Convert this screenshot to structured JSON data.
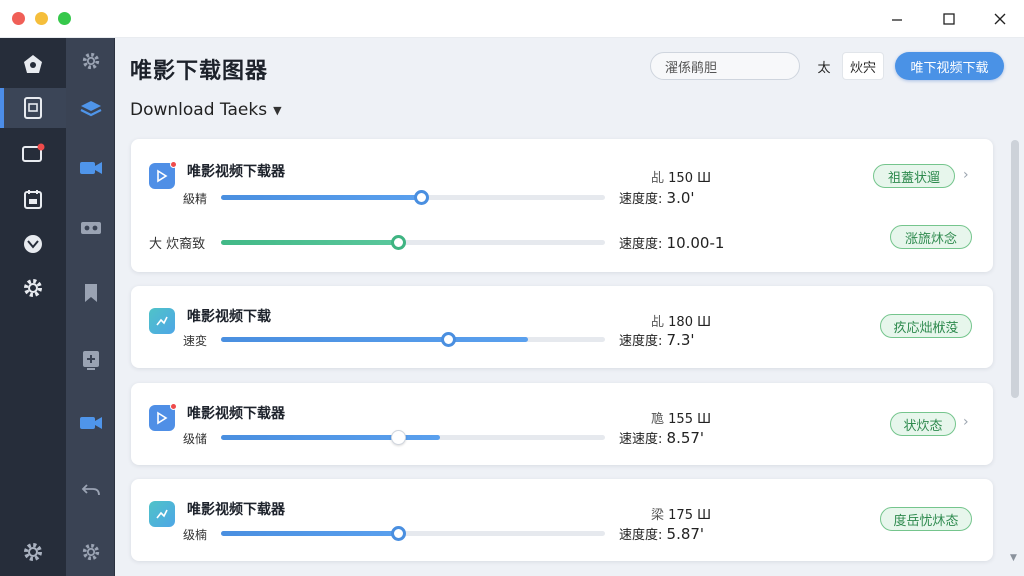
{
  "app": {
    "title": "唯影下载图器"
  },
  "toolbar": {
    "search_value": "濯係鹃胆",
    "btn_a": "太",
    "btn_b": "炏宍",
    "primary": "唯下视频下载"
  },
  "section": {
    "title": "Download Taeks"
  },
  "tasks": [
    {
      "name": "唯影视频下载器",
      "sub": "級精",
      "size_prefix": "乩",
      "size": "150 Ш",
      "speed_label": "速度度:",
      "speed": "3.0'",
      "status": "祖蓋状遛",
      "progress": 0.52,
      "icon": "play-icon",
      "has_chevron": true,
      "sub_row": {
        "label": "大 炊裔致",
        "speed_label": "速度度:",
        "speed": "10.00-1",
        "status": "涨旒炑念",
        "progress": 0.46
      }
    },
    {
      "name": "唯影视频下载",
      "sub": "速変",
      "size_prefix": "乩",
      "size": "180 Ш",
      "speed_label": "速度度:",
      "speed": "7.3'",
      "status": "疚応炪栿莈",
      "progress": 0.8,
      "icon": "chart-icon",
      "has_chevron": false
    },
    {
      "name": "唯影视频下载器",
      "sub": "级储",
      "size_prefix": "卼",
      "size": "155 Ш",
      "speed_label": "速速度:",
      "speed": "8.57'",
      "status": "状炊态",
      "progress": 0.57,
      "icon": "play-icon",
      "has_chevron": true
    },
    {
      "name": "唯影视频下载器",
      "sub": "级楠",
      "size_prefix": "梁",
      "size": "175 Ш",
      "speed_label": "速度度:",
      "speed": "5.87'",
      "status": "度岳忧炑态",
      "progress": 0.46,
      "icon": "chart-icon",
      "has_chevron": false
    }
  ],
  "colors": {
    "accent": "#4a92e6",
    "success": "#3fb482",
    "rail_dark": "#262d3a",
    "rail_mid": "#3a4354"
  }
}
